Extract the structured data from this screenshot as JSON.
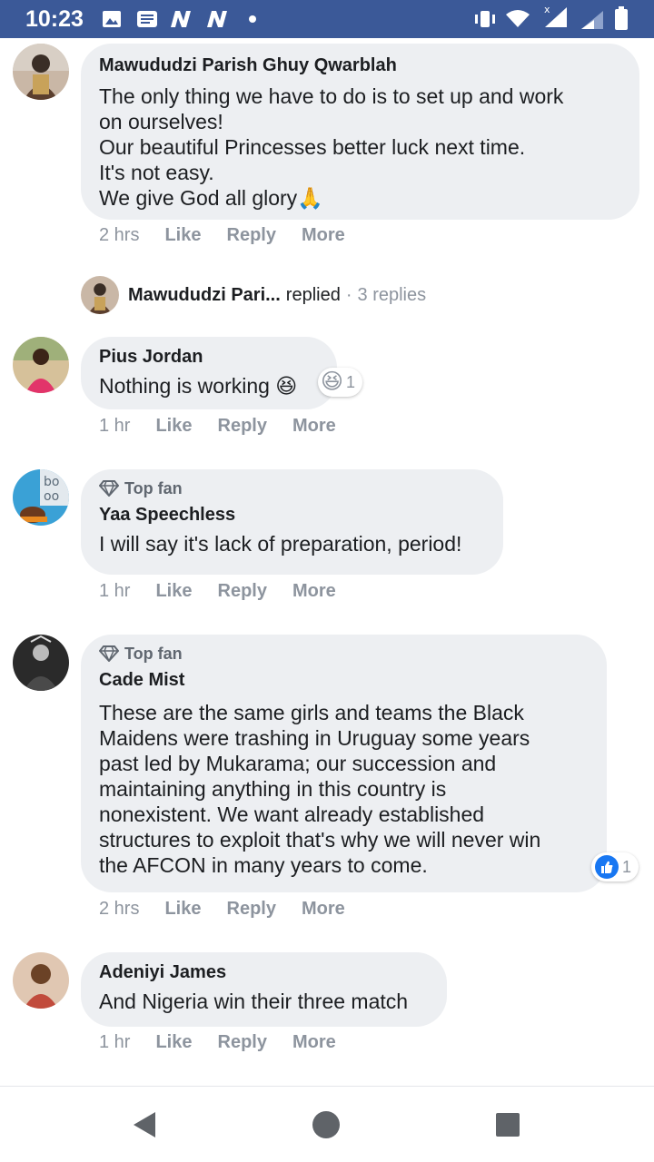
{
  "status_bar": {
    "time": "10:23",
    "bg_color": "#3b5998"
  },
  "comments": [
    {
      "author": "Mawududzi Parish Ghuy Qwarblah",
      "lines": [
        "The only thing we have to do is to set up and work",
        "on ourselves!",
        "Our beautiful Princesses better luck next time.",
        "It's not easy.",
        "We give God all glory🙏"
      ],
      "time": "2 hrs",
      "like": "Like",
      "reply": "Reply",
      "more": "More"
    },
    {
      "author": "Pius Jordan",
      "text": "Nothing is working 😆",
      "reaction_emoji": "😆",
      "reaction_count": "1",
      "time": "1 hr",
      "like": "Like",
      "reply": "Reply",
      "more": "More"
    },
    {
      "badge": "Top fan",
      "author": "Yaa Speechless",
      "text": "I will say it's lack of preparation, period!",
      "time": "1 hr",
      "like": "Like",
      "reply": "Reply",
      "more": "More"
    },
    {
      "badge": "Top fan",
      "author": "Cade Mist",
      "lines": [
        "These are the same girls and teams the Black",
        "Maidens were trashing in Uruguay some years",
        "past led by Mukarama; our succession and",
        "maintaining anything in this country is",
        "nonexistent. We want already established",
        "structures to exploit that's why we will never win",
        "the AFCON in many years to come."
      ],
      "reaction_count": "1",
      "time": "2 hrs",
      "like": "Like",
      "reply": "Reply",
      "more": "More"
    },
    {
      "author": "Adeniyi James",
      "text": "And Nigeria win their three match",
      "time": "1 hr",
      "like": "Like",
      "reply": "Reply",
      "more": "More"
    }
  ],
  "reply_summary": {
    "name": "Mawududzi Pari...",
    "verb": "replied",
    "separator": "·",
    "count": "3 replies"
  },
  "colors": {
    "bubble": "#edeff2",
    "like_blue": "#1877f2",
    "muted": "#8d949e"
  }
}
